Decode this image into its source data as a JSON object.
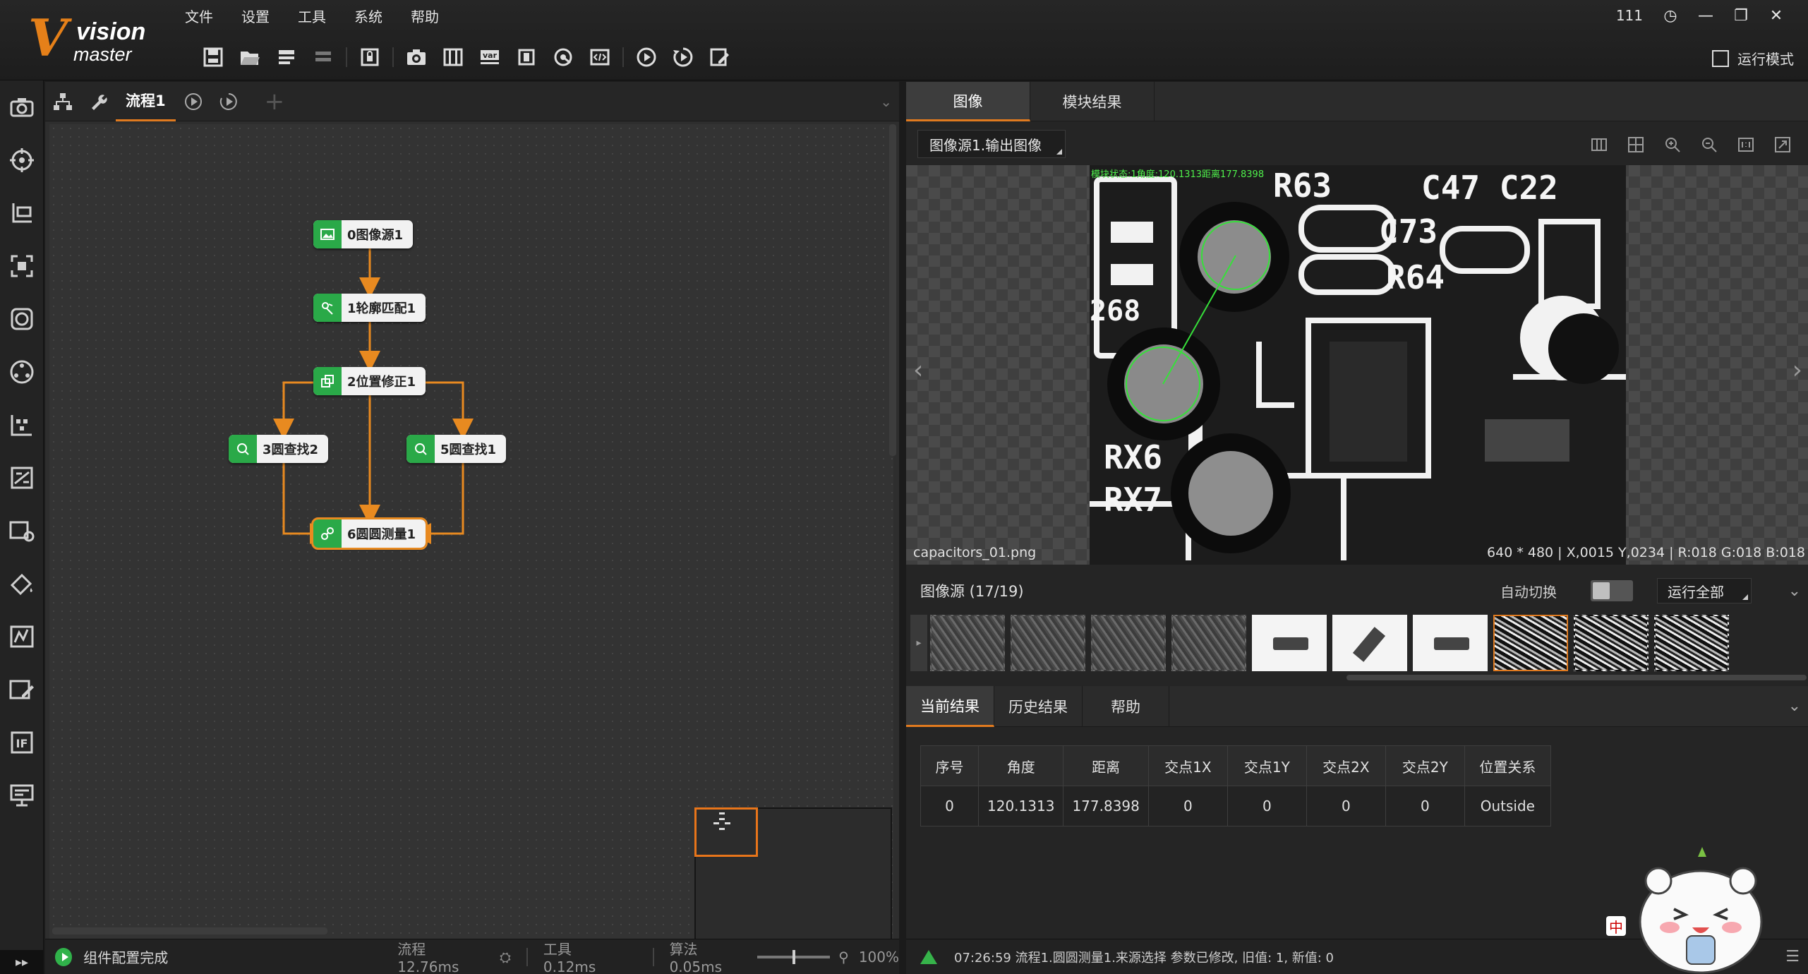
{
  "app": {
    "logo_text_1": "vision",
    "logo_text_2": "master",
    "menu": [
      "文件",
      "设置",
      "工具",
      "系统",
      "帮助"
    ],
    "user_count": "111",
    "run_mode_label": "运行模式"
  },
  "toolbar": {
    "icons": [
      "save-icon",
      "open-folder-icon",
      "import-icon",
      "export-icon",
      "lock-icon",
      "camera-icon",
      "controller-icon",
      "variable-icon",
      "data-icon",
      "communication-icon",
      "script-icon",
      "run-once-icon",
      "run-loop-icon",
      "edit-icon"
    ],
    "var_label": "var"
  },
  "left_toolbar": {
    "icons": [
      "camera-tool-icon",
      "locate-tool-icon",
      "measure-tool-icon",
      "image-process-icon",
      "recognition-icon",
      "deep-learning-icon",
      "calibration-icon",
      "compare-icon",
      "color-tool-icon",
      "defect-tool-icon",
      "logic-tool-icon",
      "image-edit-icon",
      "if-tool-icon",
      "communication-tool-icon"
    ],
    "if_label": "IF",
    "expand_label": "▸▸"
  },
  "flow": {
    "tab_label": "流程1",
    "add_label": "+",
    "collapse_label": "⌄",
    "nodes": [
      {
        "id": 0,
        "label": "0图像源1"
      },
      {
        "id": 1,
        "label": "1轮廓匹配1"
      },
      {
        "id": 2,
        "label": "2位置修正1"
      },
      {
        "id": 3,
        "label": "3圆查找2"
      },
      {
        "id": 5,
        "label": "5圆查找1"
      },
      {
        "id": 6,
        "label": "6圆圆测量1"
      }
    ]
  },
  "status_left": {
    "message": "组件配置完成",
    "flow_time": "流程  12.76ms",
    "tool_time": "工具  0.12ms",
    "algo_time": "算法  0.05ms",
    "zoom": "100%"
  },
  "image_panel": {
    "tabs": [
      "图像",
      "模块结果"
    ],
    "source_select": "图像源1.输出图像",
    "overlay_text": "模块状态:1角度:120.1313距离177.8398",
    "file_name": "capacitors_01.png",
    "image_info": "640 * 480  |  X,0015  Y,0234  |  R:018  G:018  B:018",
    "prev_label": "‹",
    "next_label": "›"
  },
  "thumbnails": {
    "title": "图像源 (17/19)",
    "auto_switch_label": "自动切换",
    "auto_switch_on": false,
    "run_all_label": "运行全部",
    "selected_index": 7,
    "items": [
      "gray",
      "gray",
      "gray",
      "gray",
      "white",
      "white",
      "white",
      "pcb",
      "pcb",
      "pcb"
    ]
  },
  "results": {
    "tabs": [
      "当前结果",
      "历史结果",
      "帮助"
    ],
    "columns": [
      "序号",
      "角度",
      "距离",
      "交点1X",
      "交点1Y",
      "交点2X",
      "交点2Y",
      "位置关系"
    ],
    "rows": [
      [
        "0",
        "120.1313",
        "177.8398",
        "0",
        "0",
        "0",
        "0",
        "Outside"
      ]
    ]
  },
  "status_right": {
    "log": "07:26:59  流程1.圆圆测量1.来源选择 参数已修改, 旧值: 1, 新值: 0"
  },
  "colors": {
    "accent": "#e07a1f",
    "node_green": "#2aa948",
    "overlay_green": "#4ff04b",
    "ok_green": "#30b24a"
  }
}
